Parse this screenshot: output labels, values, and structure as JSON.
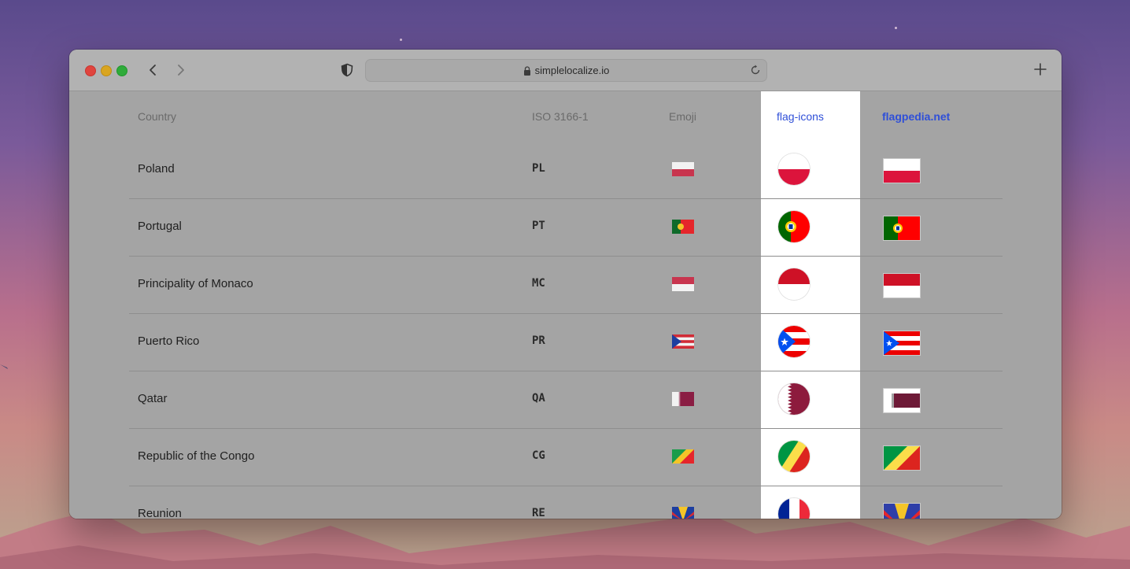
{
  "browser": {
    "url": "simplelocalize.io"
  },
  "table": {
    "headers": {
      "country": "Country",
      "iso": "ISO 3166-1",
      "emoji": "Emoji",
      "flag_icons": "flag-icons",
      "flagpedia": "flagpedia.net"
    },
    "rows": [
      {
        "country": "Poland",
        "iso": "PL",
        "flag": "flag-poland"
      },
      {
        "country": "Portugal",
        "iso": "PT",
        "flag": "flag-portugal"
      },
      {
        "country": "Principality of Monaco",
        "iso": "MC",
        "flag": "flag-monaco"
      },
      {
        "country": "Puerto Rico",
        "iso": "PR",
        "flag": "flag-puerto-rico"
      },
      {
        "country": "Qatar",
        "iso": "QA",
        "flag": "flag-qatar"
      },
      {
        "country": "Republic of the Congo",
        "iso": "CG",
        "flag": "flag-congo"
      },
      {
        "country": "Reunion",
        "iso": "RE",
        "flag": "flag-reunion"
      }
    ]
  },
  "colors": {
    "link": "#2f4fd8",
    "highlight_column": "#ffffff"
  }
}
